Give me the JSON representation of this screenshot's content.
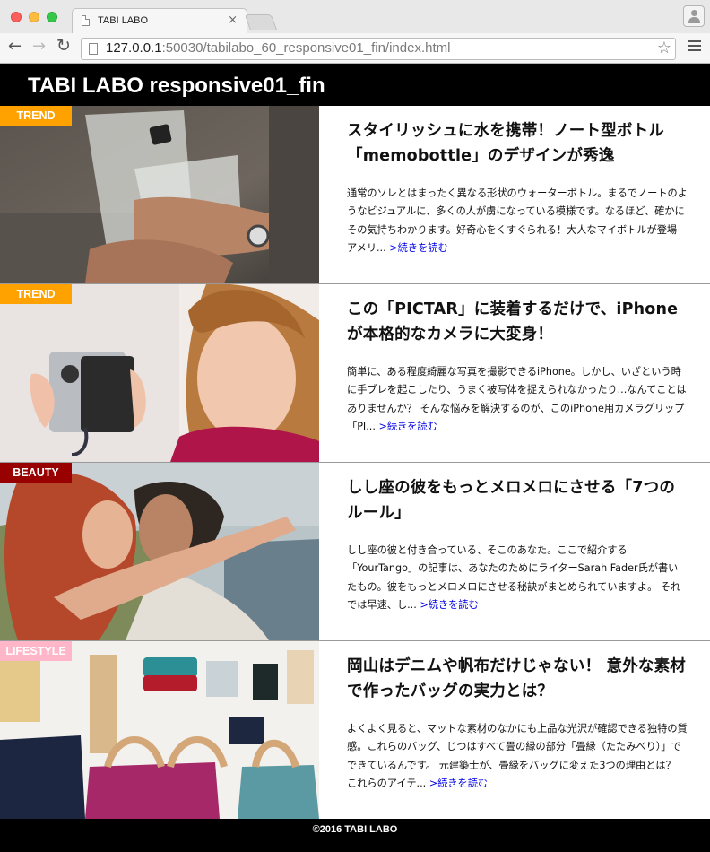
{
  "browser": {
    "tab_title": "TABI LABO",
    "tab_close": "×",
    "url_host": "127.0.0.1",
    "url_rest": ":50030/tabilabo_60_responsive01_fin/index.html"
  },
  "site": {
    "title": "TABI LABO responsive01_fin"
  },
  "articles": [
    {
      "badge": "TREND",
      "badge_color": "#ffa200",
      "headline": "スタイリッシュに水を携帯！ノート型ボトル「memobottle」のデザインが秀逸",
      "excerpt": "通常のソレとはまったく異なる形状のウォーターボトル。まるでノートのようなビジュアルに、多くの人が虜になっている模様です。なるほど、確かにその気持ちわかります。好奇心をくすぐられる！大人なマイボトルが登場 アメリ...",
      "more": ">続きを読む"
    },
    {
      "badge": "TREND",
      "badge_color": "#ffa200",
      "headline": "この「PICTAR」に装着するだけで、iPhoneが本格的なカメラに大変身！",
      "excerpt": "簡単に、ある程度綺麗な写真を撮影できるiPhone。しかし、いざという時に手ブレを起こしたり、うまく被写体を捉えられなかったり...なんてことはありませんか？ そんな悩みを解決するのが、このiPhone用カメラグリップ「PI...",
      "more": ">続きを読む"
    },
    {
      "badge": "BEAUTY",
      "badge_color": "#990000",
      "headline": "しし座の彼をもっとメロメロにさせる「7つのルール」",
      "excerpt": "しし座の彼と付き合っている、そこのあなた。ここで紹介する「YourTango」の記事は、あなたのためにライターSarah Fader氏が書いたもの。彼をもっとメロメロにさせる秘訣がまとめられていますよ。 それでは早速、し...",
      "more": ">続きを読む"
    },
    {
      "badge": "LIFESTYLE",
      "badge_color": "#ffb6c8",
      "headline": "岡山はデニムや帆布だけじゃない！ 意外な素材で作ったバッグの実力とは？",
      "excerpt": "よくよく見ると、マットな素材のなかにも上品な光沢が確認できる独特の質感。これらのバッグ、じつはすべて畳の縁の部分「畳縁（たたみべり）」でできているんです。 元建築士が、畳縁をバッグに変えた3つの理由とは？ これらのアイテ...",
      "more": ">続きを読む"
    }
  ],
  "footer": {
    "copyright": "©2016 TABI LABO"
  }
}
